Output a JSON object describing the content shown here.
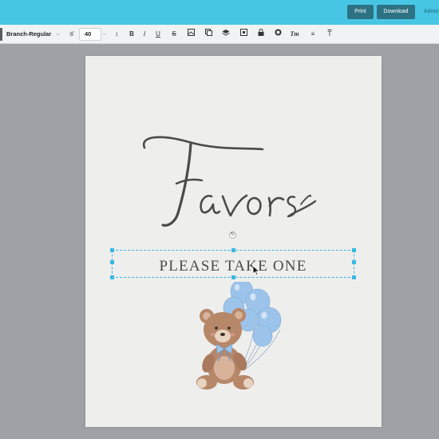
{
  "header": {
    "print_label": "Print",
    "download_label": "Download",
    "admin_label": "Admin"
  },
  "toolbar": {
    "font_family": "Branch-Regular",
    "font_size": "40",
    "icons": [
      "font-style-icon",
      "line-height-icon",
      "bold-icon",
      "italic-icon",
      "underline-icon",
      "strikethrough-icon",
      "image-icon",
      "duplicate-icon",
      "layers-icon",
      "arrange-icon",
      "lock-icon",
      "color-icon",
      "text-transform-icon",
      "list-icon",
      "clear-format-icon"
    ]
  },
  "canvas": {
    "title": "Favors",
    "subtitle": "PLEASE TAKE ONE",
    "colors": {
      "balloon": "#9cc4ea",
      "bear": "#b7876a",
      "text": "#4a4a4a",
      "selection": "#39b8df"
    }
  }
}
